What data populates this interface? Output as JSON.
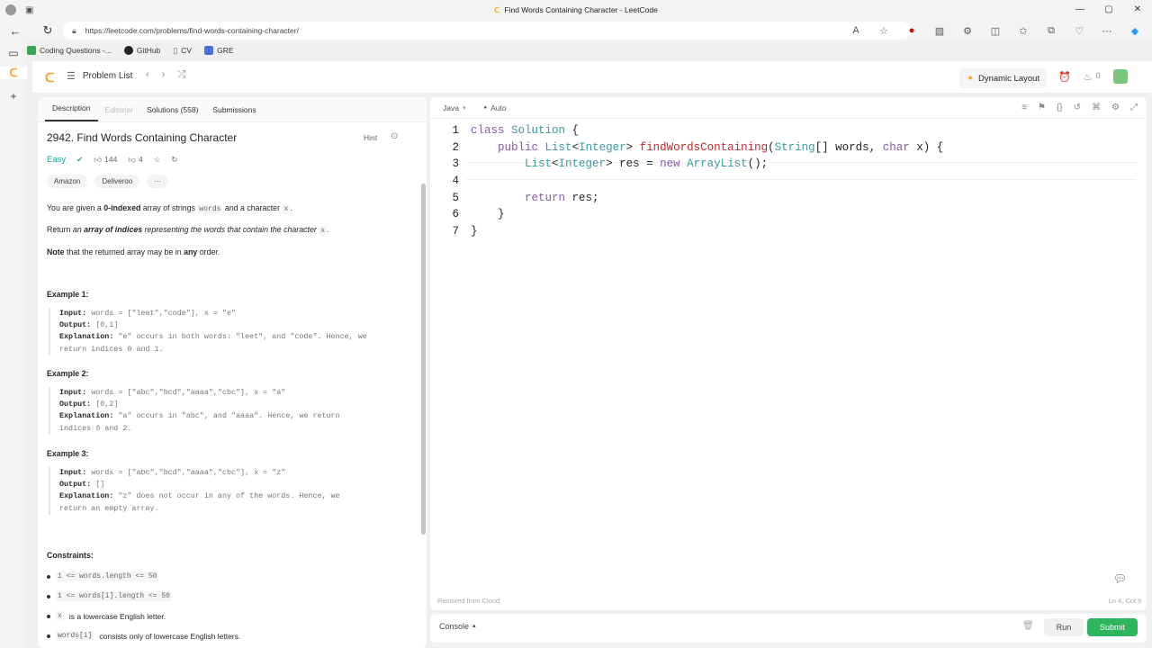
{
  "browser": {
    "window_title": "Find Words Containing Character - LeetCode",
    "url": "https://leetcode.com/problems/find-words-containing-character/",
    "bookmarks": [
      {
        "label": "Coding Questions -...",
        "color": "#34a853"
      },
      {
        "label": "GitHub",
        "color": "#222222"
      },
      {
        "label": "CV",
        "color": "#888888"
      },
      {
        "label": "GRE",
        "color": "#4a6fd8"
      }
    ]
  },
  "nav": {
    "problem_list": "Problem List",
    "dynamic_layout": "Dynamic Layout",
    "streak_count": "0"
  },
  "tabs": [
    {
      "label": "Description"
    },
    {
      "label": "Editorial"
    },
    {
      "label": "Solutions (558)"
    },
    {
      "label": "Submissions"
    }
  ],
  "problem": {
    "title": "2942. Find Words Containing Character",
    "hint": "Hint",
    "difficulty": "Easy",
    "likes": "144",
    "dislikes": "4",
    "tags": [
      "Amazon",
      "Deliveroo",
      "···"
    ]
  },
  "description": {
    "p1_a": "You are given a ",
    "p1_b": "0-indexed",
    "p1_c": " array of strings ",
    "p1_d": "words",
    "p1_e": " and a character ",
    "p1_f": "x",
    "p1_g": ".",
    "p2_a": "Return ",
    "p2_b": "an ",
    "p2_c": "array of indices",
    "p2_d": " representing the words that contain the character ",
    "p2_e": "x",
    "p2_f": ".",
    "p3_a": "Note",
    "p3_b": " that the returned array may be in ",
    "p3_c": "any",
    "p3_d": " order."
  },
  "examples": [
    {
      "title": "Example 1:",
      "input": "words = [\"leet\",\"code\"], x = \"e\"",
      "output": "[0,1]",
      "explanation_1": "\"e\" occurs in both words: \"leet\", and \"code\". Hence, we",
      "explanation_2": "return indices 0 and 1."
    },
    {
      "title": "Example 2:",
      "input": "words = [\"abc\",\"bcd\",\"aaaa\",\"cbc\"], x = \"a\"",
      "output": "[0,2]",
      "explanation_1": "\"a\" occurs in \"abc\", and \"aaaa\". Hence, we return",
      "explanation_2": "indices 0 and 2."
    },
    {
      "title": "Example 3:",
      "input": "words = [\"abc\",\"bcd\",\"aaaa\",\"cbc\"], x = \"z\"",
      "output": "[]",
      "explanation_1": "\"z\" does not occur in any of the words. Hence, we",
      "explanation_2": "return an empty array."
    }
  ],
  "labels": {
    "input": "Input:",
    "output": "Output:",
    "explanation": "Explanation:",
    "constraints": "Constraints:"
  },
  "constraints": [
    {
      "code": "1 <= words.length <= 50",
      "text": ""
    },
    {
      "code": "1 <= words[i].length <= 50",
      "text": ""
    },
    {
      "code": "x",
      "text": " is a lowercase English letter."
    },
    {
      "code": "words[i]",
      "text": " consists only of lowercase English letters."
    }
  ],
  "editor": {
    "language": "Java",
    "mode": "Auto",
    "restored": "Restored from Cloud",
    "cursor_pos": "Ln 4, Col 9",
    "line_numbers": [
      "1",
      "2",
      "3",
      "4",
      "5",
      "6",
      "7"
    ]
  },
  "console": {
    "label": "Console",
    "run": "Run",
    "submit": "Submit"
  }
}
